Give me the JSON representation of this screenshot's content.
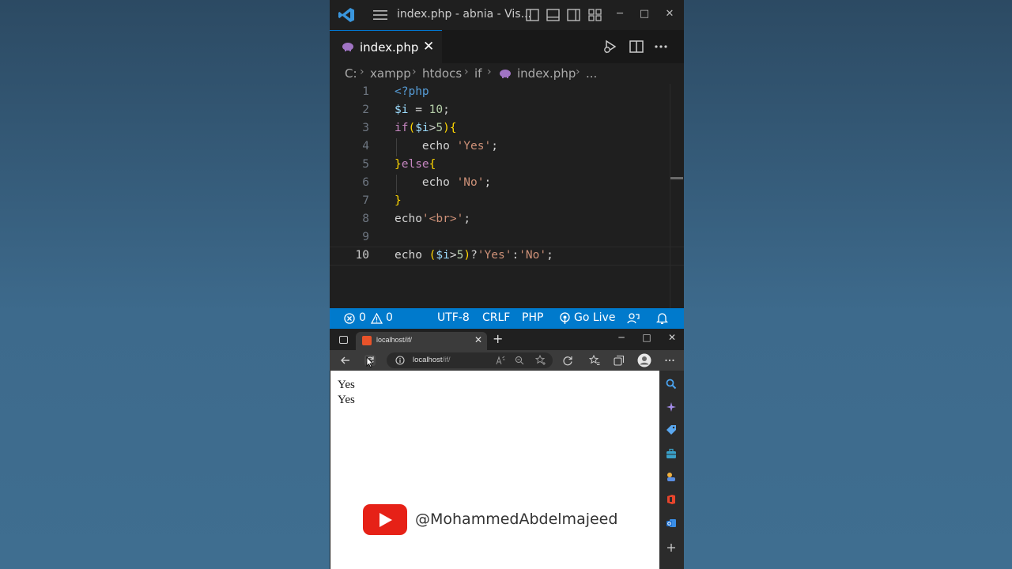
{
  "vscode": {
    "window_title": "index.php - abnia - Vis...",
    "window_controls": {
      "minimize": "─",
      "maximize": "□",
      "close": "✕"
    },
    "tab": {
      "label": "index.php",
      "close": "✕"
    },
    "breadcrumb": {
      "items": [
        "C:",
        "xampp",
        "htdocs",
        "if",
        "index.php",
        "..."
      ],
      "separator": "›"
    },
    "editor": {
      "line_numbers": [
        "1",
        "2",
        "3",
        "4",
        "5",
        "6",
        "7",
        "8",
        "9",
        "10"
      ],
      "active_line": "10",
      "lines": [
        "<?php",
        "$i = 10;",
        "if($i>5){",
        "    echo 'Yes';",
        "}else{",
        "    echo 'No';",
        "}",
        "echo'<br>';",
        "",
        "echo ($i>5)?'Yes':'No';"
      ]
    },
    "status": {
      "errors": "0",
      "warnings": "0",
      "encoding": "UTF-8",
      "eol": "CRLF",
      "language": "PHP",
      "go_live": "Go Live"
    },
    "colors": {
      "accent": "#007acc",
      "editor_bg": "#1f1f1f"
    }
  },
  "browser": {
    "tab_label": "localhost/if/",
    "tab_close": "✕",
    "new_tab": "+",
    "window_controls": {
      "minimize": "─",
      "maximize": "□",
      "close": "✕"
    },
    "address": {
      "host": "localhost",
      "path": "/if/"
    },
    "page_output": [
      "Yes",
      "Yes"
    ],
    "toolbar_more": "···"
  },
  "watermark": {
    "handle": "@MohammedAbdelmajeed"
  }
}
